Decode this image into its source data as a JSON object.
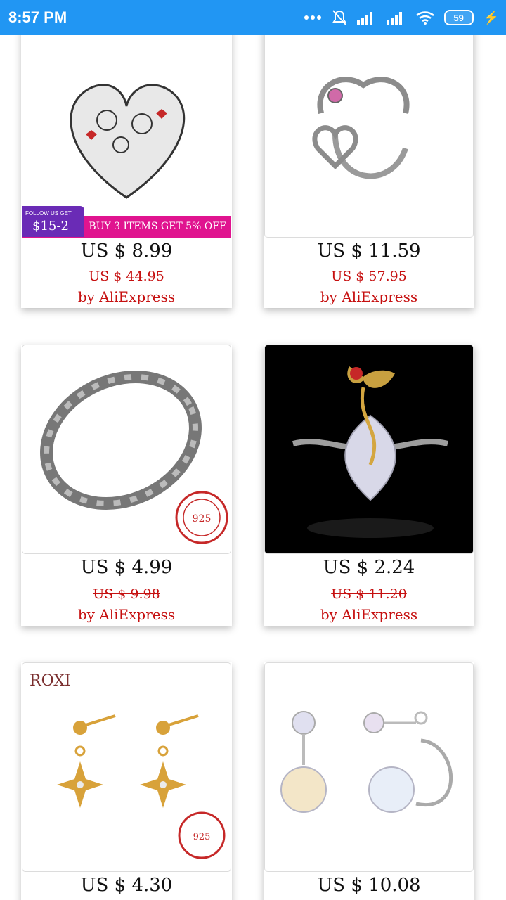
{
  "status_bar": {
    "time": "8:57 PM",
    "battery": "59"
  },
  "products": [
    {
      "price": "US $ 8.99",
      "original_price": "US $ 44.95",
      "seller": "by AliExpress",
      "promo": {
        "follow_text": "FOLLOW US GET",
        "discount": "$15-2",
        "offer": "BUY 3 ITEMS GET 5% OFF"
      }
    },
    {
      "price": "US $ 11.59",
      "original_price": "US $ 57.95",
      "seller": "by AliExpress"
    },
    {
      "price": "US $ 4.99",
      "original_price": "US $ 9.98",
      "seller": "by AliExpress",
      "stamp": "925"
    },
    {
      "price": "US $ 2.24",
      "original_price": "US $ 11.20",
      "seller": "by AliExpress"
    },
    {
      "price": "US $ 4.30",
      "original_price": "",
      "seller": "",
      "brand": "ROXI",
      "stamp": "925"
    },
    {
      "price": "US $ 10.08",
      "original_price": "",
      "seller": ""
    }
  ]
}
